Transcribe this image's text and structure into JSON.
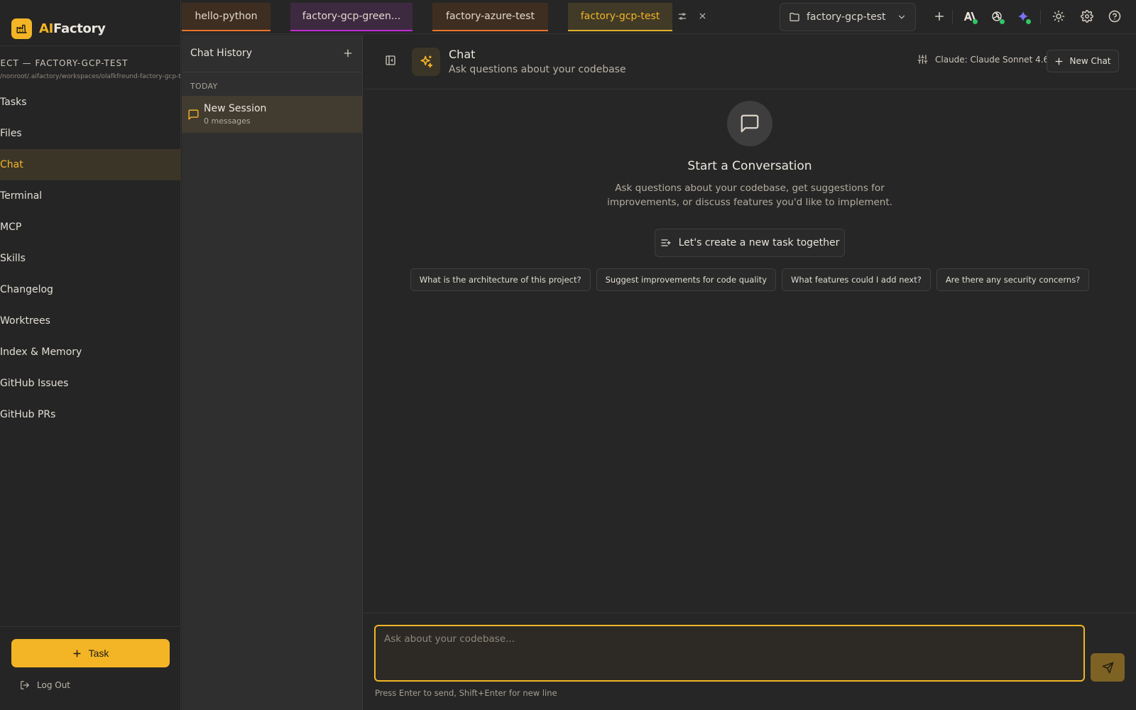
{
  "brand": {
    "part1": "AI",
    "part2": "Factory"
  },
  "sidebar": {
    "project_label": "JECT — FACTORY-GCP-TEST",
    "project_path": "/nonroot/.aifactory/workspaces/olafkfreund-factory-gcp-test",
    "items": [
      {
        "label": "Tasks",
        "active": false
      },
      {
        "label": "Files",
        "active": false
      },
      {
        "label": "Chat",
        "active": true
      },
      {
        "label": "Terminal",
        "active": false
      },
      {
        "label": "MCP",
        "active": false
      },
      {
        "label": "Skills",
        "active": false
      },
      {
        "label": "Changelog",
        "active": false
      },
      {
        "label": "Worktrees",
        "active": false
      },
      {
        "label": "Index & Memory",
        "active": false
      },
      {
        "label": "GitHub Issues",
        "active": false
      },
      {
        "label": "GitHub PRs",
        "active": false
      }
    ],
    "task_button": "Task",
    "logout": "Log Out"
  },
  "tabs": [
    {
      "label": "hello-python",
      "color": "#e8742a",
      "active": false
    },
    {
      "label": "factory-gcp-green...",
      "color": "#c02ad0",
      "active": false
    },
    {
      "label": "factory-azure-test",
      "color": "#e8742a",
      "active": false
    },
    {
      "label": "factory-gcp-test",
      "color": "#e0b02a",
      "active": true
    }
  ],
  "project_selector": {
    "value": "factory-gcp-test"
  },
  "history": {
    "title": "Chat History",
    "group": "TODAY",
    "sessions": [
      {
        "title": "New Session",
        "subtitle": "0 messages"
      }
    ]
  },
  "chat": {
    "title": "Chat",
    "subtitle": "Ask questions about your codebase",
    "model": "Claude: Claude Sonnet 4.6",
    "new_chat": "New Chat",
    "empty_title": "Start a Conversation",
    "empty_desc": "Ask questions about your codebase, get suggestions for improvements, or discuss features you'd like to implement.",
    "create_task": "Let's create a new task together",
    "suggestions": [
      "What is the architecture of this project?",
      "Suggest improvements for code quality",
      "What features could I add next?",
      "Are there any security concerns?"
    ],
    "input_placeholder": "Ask about your codebase...",
    "hint": "Press Enter to send, Shift+Enter for new line"
  },
  "colors": {
    "accent": "#f3b526",
    "background": "#262626",
    "active_item_bg": "#3b3528",
    "status_green": "#2ec866"
  }
}
